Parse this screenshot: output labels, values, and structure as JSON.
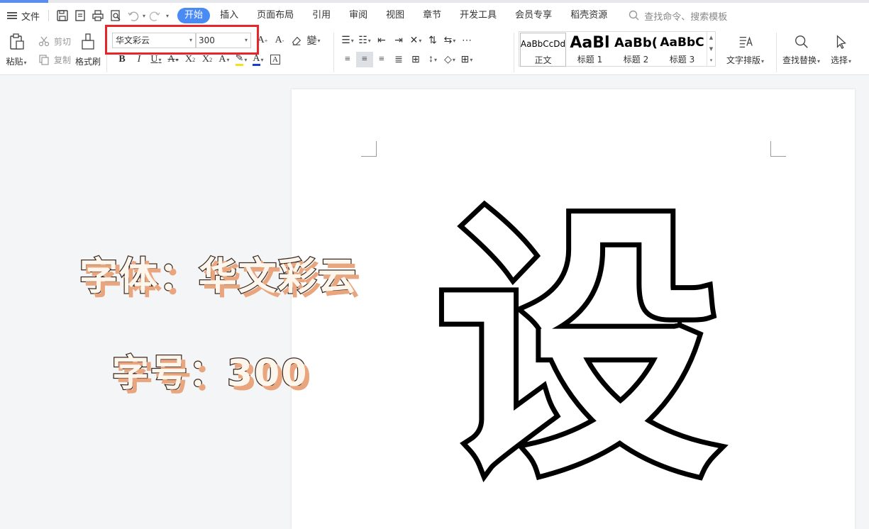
{
  "menubar": {
    "file_label": "文件",
    "tabs": [
      {
        "label": "开始",
        "active": true
      },
      {
        "label": "插入"
      },
      {
        "label": "页面布局"
      },
      {
        "label": "引用"
      },
      {
        "label": "审阅"
      },
      {
        "label": "视图"
      },
      {
        "label": "章节"
      },
      {
        "label": "开发工具"
      },
      {
        "label": "会员专享"
      },
      {
        "label": "稻壳资源"
      }
    ],
    "search_placeholder": "查找命令、搜索模板"
  },
  "ribbon": {
    "paste_label": "粘贴",
    "cut_label": "剪切",
    "copy_label": "复制",
    "format_painter_label": "格式刷",
    "font_name": "华文彩云",
    "font_size": "300",
    "styles": [
      {
        "preview": "AaBbCcDd",
        "label": "正文"
      },
      {
        "preview": "AaBl",
        "label": "标题 1"
      },
      {
        "preview": "AaBb(",
        "label": "标题 2"
      },
      {
        "preview": "AaBbC",
        "label": "标题 3"
      }
    ],
    "text_layout_label": "文字排版",
    "find_replace_label": "查找替换",
    "select_label": "选择"
  },
  "document": {
    "big_char": "设"
  },
  "overlay": {
    "line1": "字体：华文彩云",
    "line2": "字号：300"
  },
  "colors": {
    "accent": "#4a8af4",
    "highlight_box": "#e8262a",
    "overlay_shadow": "#e9a57e"
  }
}
